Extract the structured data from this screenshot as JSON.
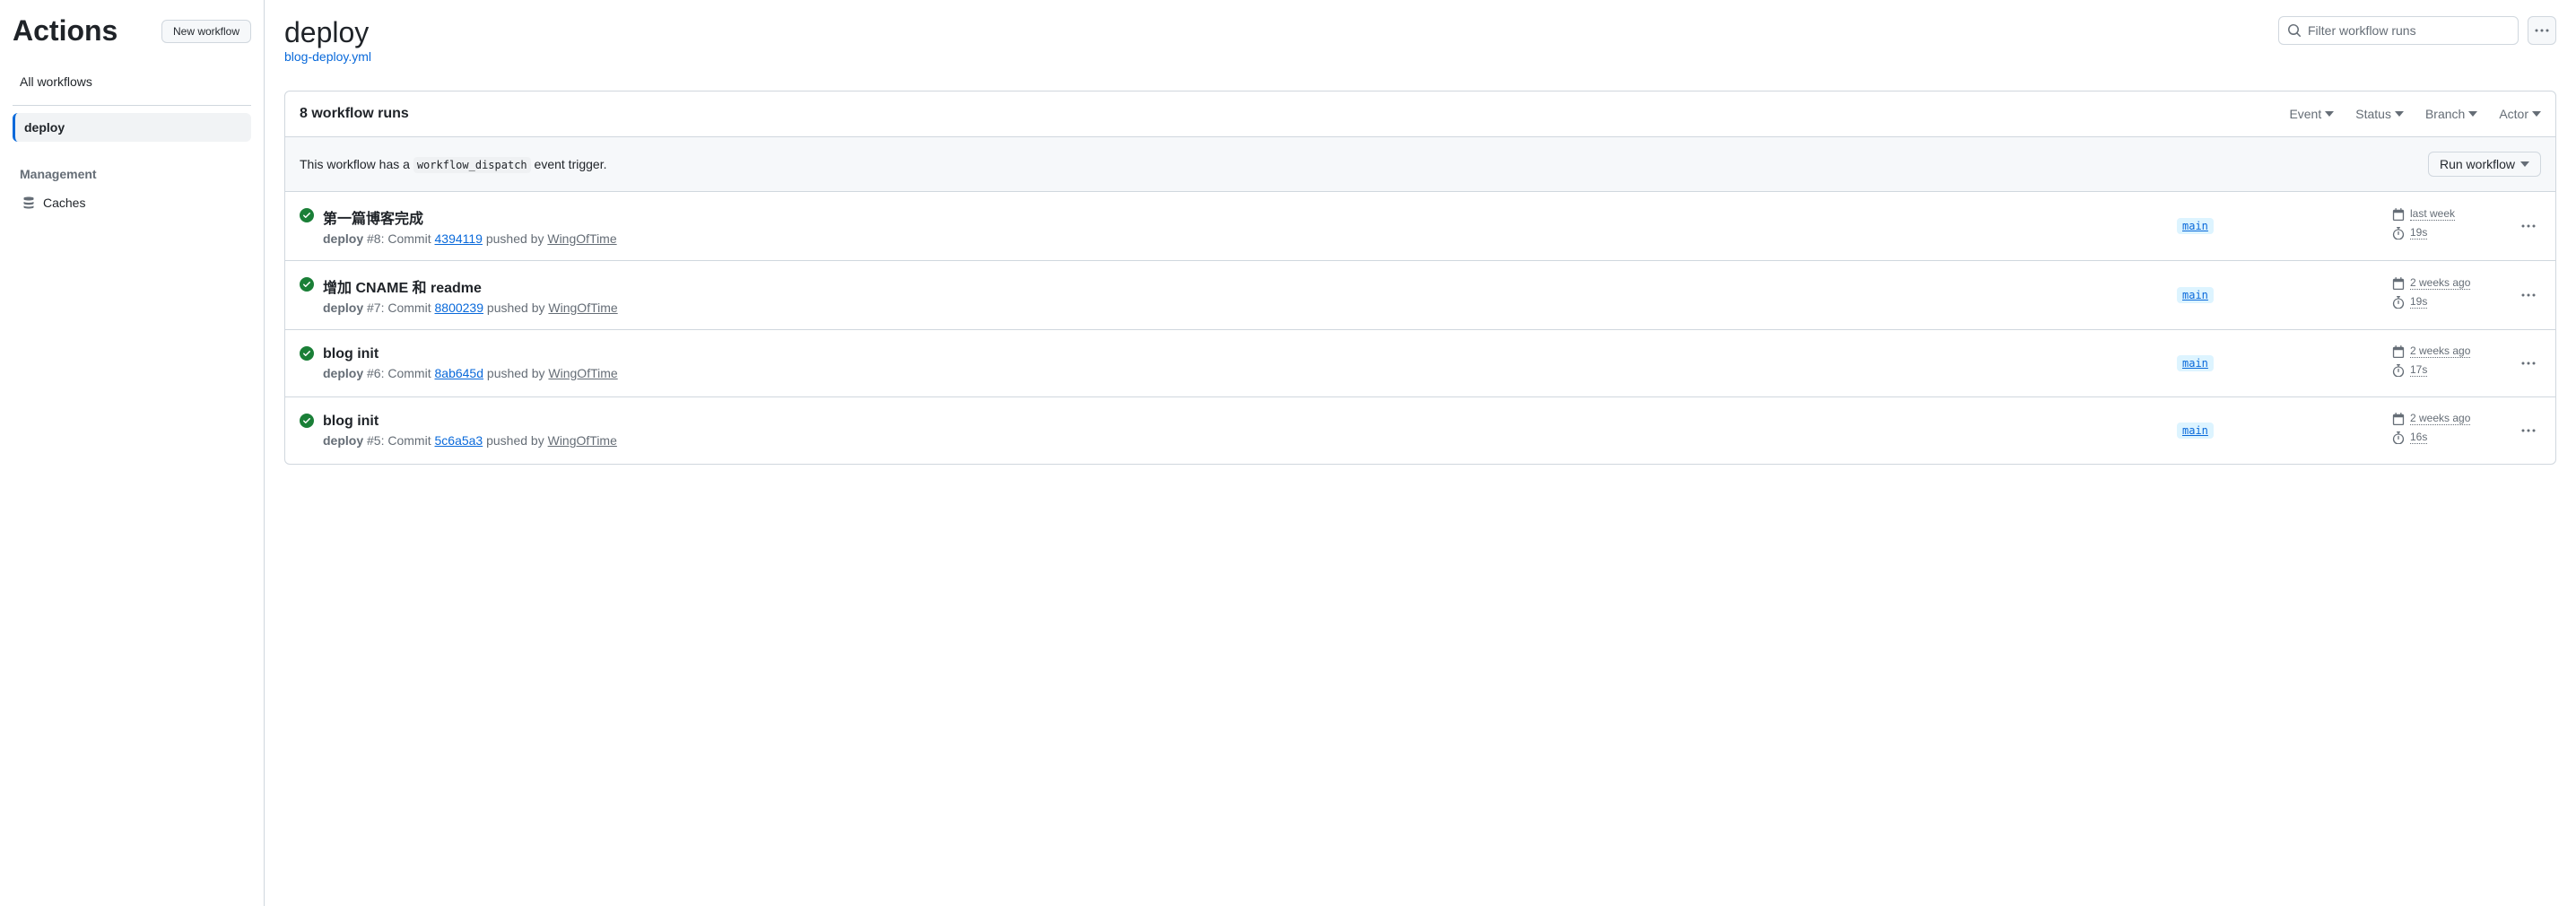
{
  "sidebar": {
    "title": "Actions",
    "new_workflow_label": "New workflow",
    "all_workflows_label": "All workflows",
    "workflows": [
      {
        "name": "deploy",
        "active": true
      }
    ],
    "management_label": "Management",
    "caches_label": "Caches"
  },
  "header": {
    "title": "deploy",
    "file_link": "blog-deploy.yml",
    "search_placeholder": "Filter workflow runs"
  },
  "runs_header": {
    "count_label": "8 workflow runs",
    "filters": {
      "event": "Event",
      "status": "Status",
      "branch": "Branch",
      "actor": "Actor"
    }
  },
  "dispatch_row": {
    "prefix": "This workflow has a ",
    "code": "workflow_dispatch",
    "suffix": " event trigger.",
    "run_label": "Run workflow"
  },
  "runs": [
    {
      "title": "第一篇博客完成",
      "workflow_name": "deploy",
      "run_number": "#8",
      "colon": ": ",
      "commit_prefix": "Commit ",
      "commit_sha": "4394119",
      "pushed_by": " pushed by ",
      "actor": "WingOfTime",
      "branch": "main",
      "when": "last week",
      "duration": "19s"
    },
    {
      "title": "增加 CNAME 和 readme",
      "workflow_name": "deploy",
      "run_number": "#7",
      "colon": ": ",
      "commit_prefix": "Commit ",
      "commit_sha": "8800239",
      "pushed_by": " pushed by ",
      "actor": "WingOfTime",
      "branch": "main",
      "when": "2 weeks ago",
      "duration": "19s"
    },
    {
      "title": "blog init",
      "workflow_name": "deploy",
      "run_number": "#6",
      "colon": ": ",
      "commit_prefix": "Commit ",
      "commit_sha": "8ab645d",
      "pushed_by": " pushed by ",
      "actor": "WingOfTime",
      "branch": "main",
      "when": "2 weeks ago",
      "duration": "17s"
    },
    {
      "title": "blog init",
      "workflow_name": "deploy",
      "run_number": "#5",
      "colon": ": ",
      "commit_prefix": "Commit ",
      "commit_sha": "5c6a5a3",
      "pushed_by": " pushed by ",
      "actor": "WingOfTime",
      "branch": "main",
      "when": "2 weeks ago",
      "duration": "16s"
    }
  ]
}
